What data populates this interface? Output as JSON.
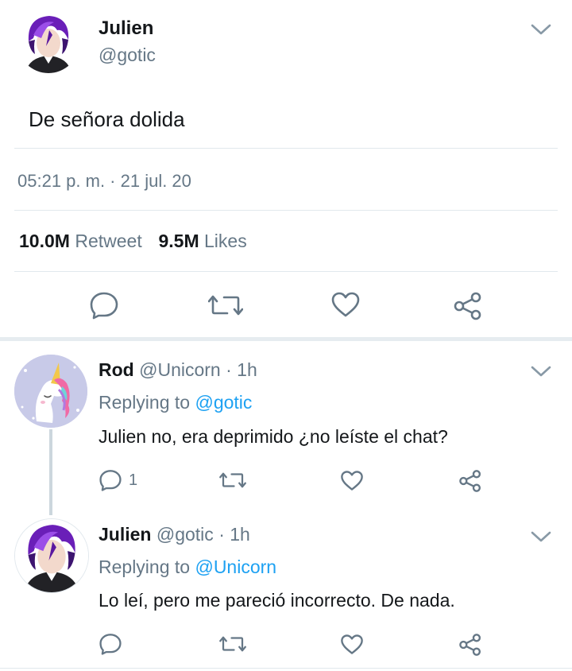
{
  "main_tweet": {
    "display_name": "Julien",
    "handle": "@gotic",
    "text": "De señora dolida",
    "timestamp": "05:21 p. m. · 21 jul. 20",
    "retweets_count": "10.0M",
    "retweets_label": "Retweet",
    "likes_count": "9.5M",
    "likes_label": "Likes"
  },
  "replies": [
    {
      "display_name": "Rod",
      "handle": "@Unicorn",
      "time": "· 1h",
      "replying_prefix": "Replying to",
      "replying_to": "@gotic",
      "text": "Julien no, era deprimido ¿no leíste el chat?",
      "reply_count": "1"
    },
    {
      "display_name": "Julien",
      "handle": "@gotic",
      "time": "· 1h",
      "replying_prefix": "Replying to",
      "replying_to": "@Unicorn",
      "text": "Lo leí, pero me pareció incorrecto. De nada.",
      "reply_count": ""
    }
  ],
  "icons": [
    "chevron-down-icon",
    "reply-icon",
    "retweet-icon",
    "like-icon",
    "share-icon"
  ],
  "colors": {
    "accent": "#1da1f2",
    "muted": "#657786",
    "divider": "#e1e8ed"
  }
}
